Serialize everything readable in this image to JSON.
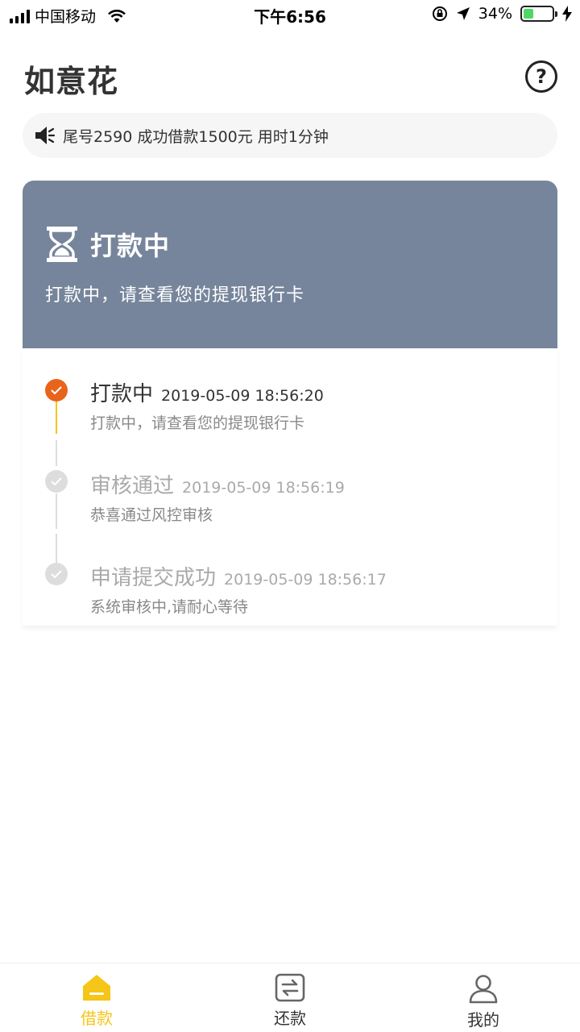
{
  "status_bar": {
    "carrier": "中国移动",
    "time": "下午6:56",
    "battery": "34%",
    "battery_level": 0.34
  },
  "header": {
    "title": "如意花",
    "help_symbol": "?"
  },
  "notice": {
    "text": "尾号2590 成功借款1500元 用时1分钟"
  },
  "status_card": {
    "title": "打款中",
    "description": "打款中，请查看您的提现银行卡"
  },
  "timeline": [
    {
      "title": "打款中",
      "time": "2019-05-09 18:56:20",
      "desc": "打款中，请查看您的提现银行卡",
      "active": true
    },
    {
      "title": "审核通过",
      "time": "2019-05-09 18:56:19",
      "desc": "恭喜通过风控审核",
      "active": false
    },
    {
      "title": "申请提交成功",
      "time": "2019-05-09 18:56:17",
      "desc": "系统审核中,请耐心等待",
      "active": false
    }
  ],
  "tabs": [
    {
      "label": "借款",
      "icon": "home-icon",
      "active": true
    },
    {
      "label": "还款",
      "icon": "exchange-icon",
      "active": false
    },
    {
      "label": "我的",
      "icon": "user-icon",
      "active": false
    }
  ],
  "colors": {
    "accent": "#f5c518",
    "active_dot": "#e8641c",
    "card_bg": "#76859b",
    "inactive": "#aaaaaa"
  }
}
